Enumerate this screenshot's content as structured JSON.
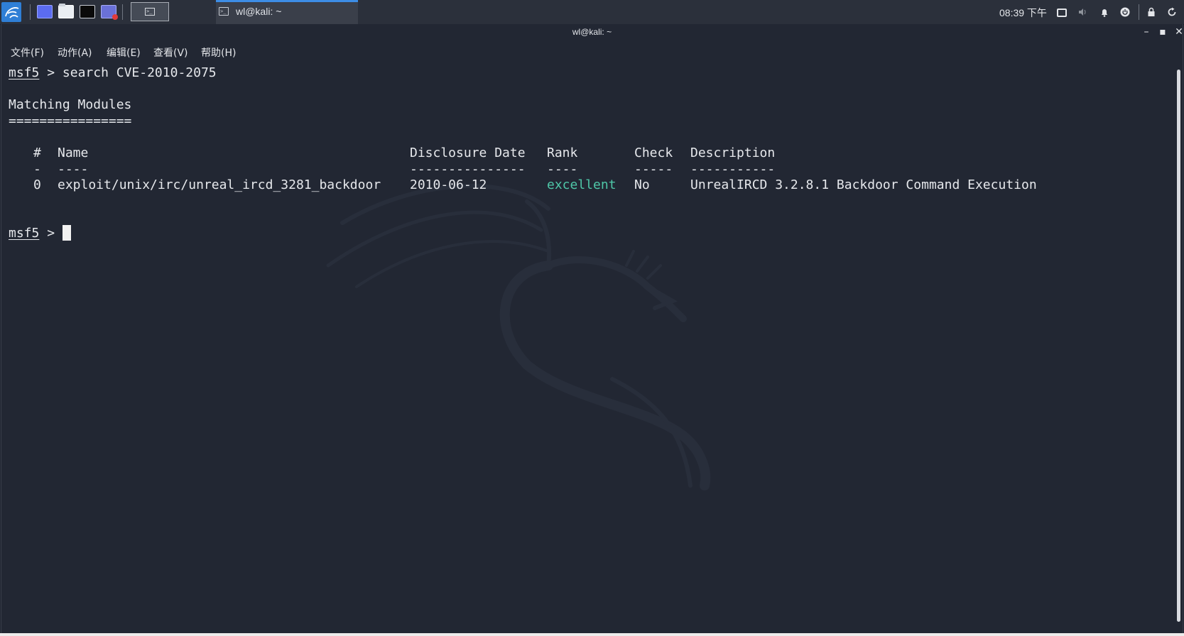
{
  "taskbar": {
    "clock": "08:39 下午",
    "window_task_label": "wl@kali: ~",
    "workspace_glyph": ">_",
    "task_glyph": ">_",
    "icons": [
      "kali-menu-icon",
      "desktop-icon",
      "file-manager-icon",
      "terminal-icon",
      "screen-recorder-icon",
      "display-icon",
      "volume-icon",
      "bell-icon",
      "power-icon",
      "lock-icon",
      "refresh-icon"
    ]
  },
  "window": {
    "title": "wl@kali: ~",
    "controls": {
      "minimize": "–",
      "maximize": "▪",
      "close": "✕"
    }
  },
  "menubar": {
    "items": [
      "文件(F)",
      "动作(A)",
      "编辑(E)",
      "查看(V)",
      "帮助(H)"
    ]
  },
  "terminal": {
    "prompt": "msf5",
    "prompt_arrow": ">",
    "command": "search CVE-2010-2075",
    "heading": "Matching Modules",
    "heading_rule": "================",
    "columns": [
      "#",
      "Name",
      "Disclosure Date",
      "Rank",
      "Check",
      "Description"
    ],
    "column_rules": [
      "-",
      "----",
      "---------------",
      "----",
      "-----",
      "-----------"
    ],
    "rows": [
      {
        "index": "0",
        "name": "exploit/unix/irc/unreal_ircd_3281_backdoor",
        "date": "2010-06-12",
        "rank": "excellent",
        "check": "No",
        "description": "UnrealIRCD 3.2.8.1 Backdoor Command Execution"
      }
    ]
  },
  "colors": {
    "background": "#222733",
    "text": "#e6e8ec",
    "rank_excellent": "#4fc7a8",
    "taskbar": "#2b303b",
    "active_task_indicator": "#3d8de5"
  }
}
